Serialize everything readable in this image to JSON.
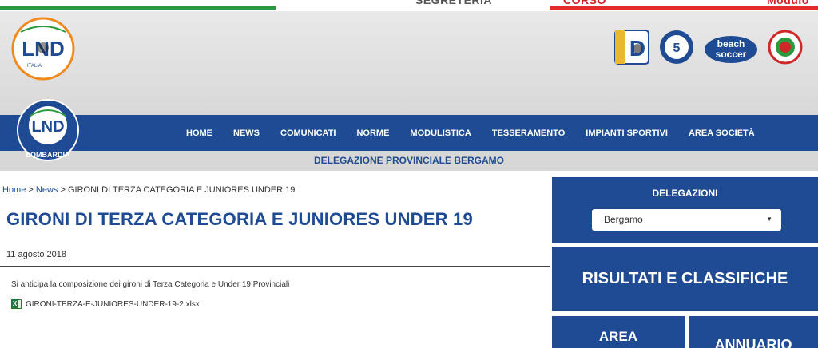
{
  "top_links": {
    "left": "SEGRETERIA",
    "right": "CORSO",
    "far": "Modulo"
  },
  "nav": {
    "items": [
      "HOME",
      "NEWS",
      "COMUNICATI",
      "NORME",
      "MODULISTICA",
      "TESSERAMENTO",
      "IMPIANTI SPORTIVI",
      "AREA SOCIETÀ"
    ],
    "subtitle": "DELEGAZIONE PROVINCIALE BERGAMO"
  },
  "logos": {
    "lnd_main": "LND",
    "lnd_lombardia": "LOMBARDIA",
    "partners": [
      "SERIE D",
      "calcio a 5",
      "beach soccer",
      "calcio femminile"
    ]
  },
  "breadcrumb": {
    "home": "Home",
    "sep": " > ",
    "news": "News",
    "current": "GIRONI DI TERZA CATEGORIA E JUNIORES UNDER 19"
  },
  "article": {
    "title": "GIRONI DI TERZA CATEGORIA E JUNIORES UNDER 19",
    "date": "11 agosto 2018",
    "intro": "Si anticipa la composizione dei gironi di Terza Categoria e Under 19 Provinciali",
    "attachment": "GIRONI-TERZA-E-JUNIORES-UNDER-19-2.xlsx"
  },
  "sidebar": {
    "delegazioni_title": "DELEGAZIONI",
    "delegazioni_selected": "Bergamo",
    "risultati": "RISULTATI E CLASSIFICHE",
    "area": "AREA",
    "annuario": "ANNUARIO"
  },
  "colors": {
    "brand_blue": "#1e4b93",
    "header_grey": "#e0e0e0",
    "stripe_green": "#2b9a3c",
    "stripe_red": "#e32b2b"
  }
}
